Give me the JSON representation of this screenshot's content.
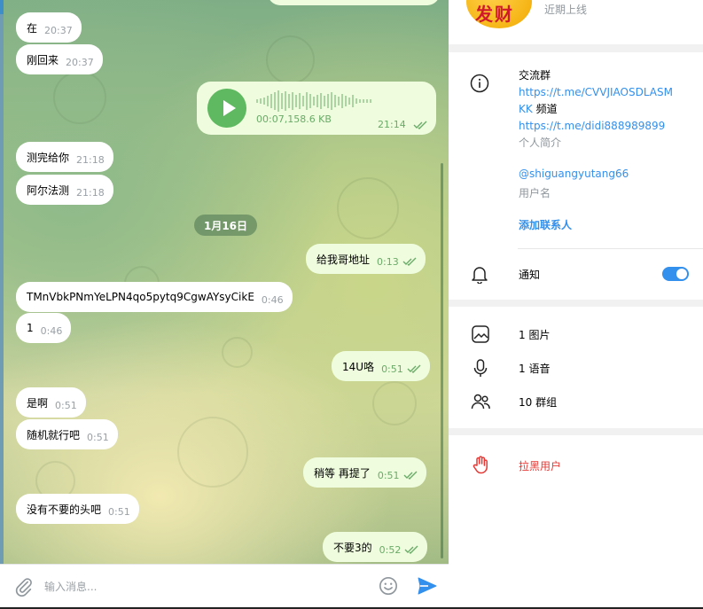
{
  "chat": {
    "messages": [
      {
        "id": "m1",
        "dir": "in",
        "text": "在",
        "time": "20:37"
      },
      {
        "id": "m2",
        "dir": "in",
        "text": "刚回来",
        "time": "20:37"
      },
      {
        "id": "m3",
        "dir": "out",
        "type": "voice",
        "duration": "00:07",
        "size": "158.6 KB",
        "time": "21:14"
      },
      {
        "id": "m4",
        "dir": "in",
        "text": "测完给你",
        "time": "21:18"
      },
      {
        "id": "m5",
        "dir": "in",
        "text": "阿尔法测",
        "time": "21:18"
      },
      {
        "id": "m6",
        "dir": "out",
        "text": "给我哥地址",
        "time": "0:13"
      },
      {
        "id": "m7",
        "dir": "in",
        "text": "TMnVbkPNmYeLPN4qo5pytq9CgwAYsyCikE",
        "time": "0:46"
      },
      {
        "id": "m8",
        "dir": "in",
        "text": "1",
        "time": "0:46"
      },
      {
        "id": "m9",
        "dir": "out",
        "text": "14U咯",
        "time": "0:51"
      },
      {
        "id": "m10",
        "dir": "in",
        "text": "是啊",
        "time": "0:51"
      },
      {
        "id": "m11",
        "dir": "in",
        "text": "随机就行吧",
        "time": "0:51"
      },
      {
        "id": "m12",
        "dir": "out",
        "text": "稍等 再提了",
        "time": "0:51"
      },
      {
        "id": "m13",
        "dir": "in",
        "text": "没有不要的头吧",
        "time": "0:51"
      },
      {
        "id": "m14",
        "dir": "out",
        "text": "不要3的",
        "time": "0:52"
      }
    ],
    "date_separator": "1月16日",
    "voice_meta": "00:07,158.6 KB",
    "composer_placeholder": "输入消息..."
  },
  "profile": {
    "avatar_text": "发财",
    "last_seen": "近期上线",
    "bio_title": "交流群",
    "bio_link1": "https://t.me/CVVJIAOSDLASM",
    "bio_link1_cont": "KK",
    "bio_channel_label": "频道",
    "bio_link2": "https://t.me/didi888989899",
    "bio_label": "个人简介",
    "username": "@shiguangyutang66",
    "username_label": "用户名",
    "add_contact": "添加联系人",
    "notifications_label": "通知",
    "notifications_on": true,
    "media": [
      {
        "icon": "image-icon",
        "label": "1 图片"
      },
      {
        "icon": "microphone-icon",
        "label": "1 语音"
      },
      {
        "icon": "groups-icon",
        "label": "10 群组"
      }
    ],
    "block_user": "拉黑用户"
  },
  "colors": {
    "accent": "#3390ec",
    "danger": "#e53935",
    "outgoing_bubble": "#effdde",
    "check_green": "#6aab68"
  }
}
